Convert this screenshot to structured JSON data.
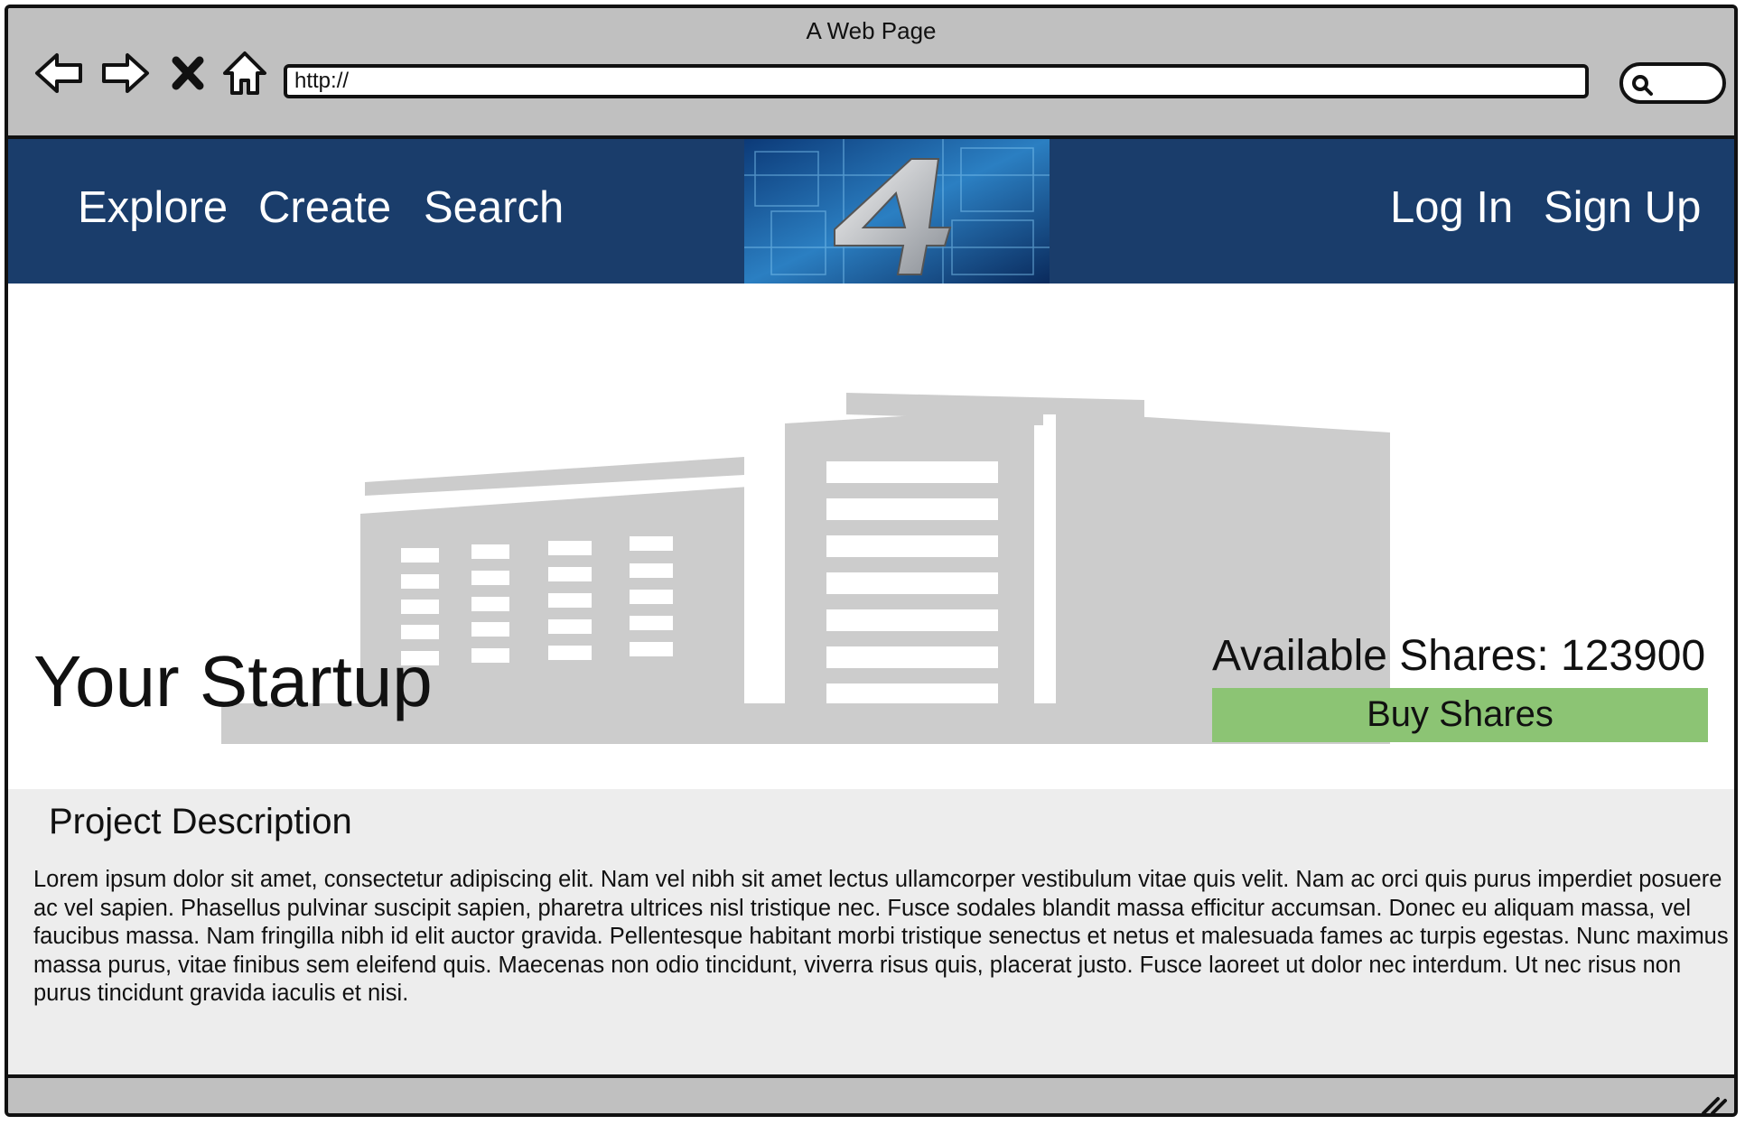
{
  "window": {
    "title": "A Web Page"
  },
  "toolbar": {
    "back_icon": "back-arrow-icon",
    "forward_icon": "forward-arrow-icon",
    "stop_icon": "close-icon",
    "home_icon": "home-icon",
    "url_value": "http://",
    "search_icon": "search-icon"
  },
  "nav": {
    "left_links": [
      "Explore",
      "Create",
      "Search"
    ],
    "right_links": [
      "Log In",
      "Sign Up"
    ],
    "logo_letter": "4"
  },
  "hero": {
    "title": "Your Startup",
    "available_shares": "Available Shares: 123900",
    "buy_button": "Buy Shares"
  },
  "description": {
    "heading": "Project Description",
    "body": "Lorem ipsum dolor sit amet, consectetur adipiscing elit. Nam vel nibh sit amet lectus ullamcorper vestibulum vitae quis velit. Nam ac orci quis purus imperdiet posuere ac vel sapien. Phasellus pulvinar suscipit sapien, pharetra ultrices nisl tristique nec. Fusce sodales blandit massa efficitur accumsan. Donec eu aliquam massa, vel faucibus massa. Nam fringilla nibh id elit auctor gravida. Pellentesque habitant morbi tristique senectus et netus et malesuada fames ac turpis egestas. Nunc maximus massa purus, vitae finibus sem eleifend quis. Maecenas non odio tincidunt, viverra risus quis, placerat justo. Fusce laoreet ut dolor nec interdum. Ut nec risus non purus tincidunt gravida iaculis et nisi."
  },
  "colors": {
    "nav_bg": "#1a3d6b",
    "buy_button_bg": "#8cc474",
    "description_bg": "#ededed",
    "chrome_bg": "#c0c0c0"
  }
}
